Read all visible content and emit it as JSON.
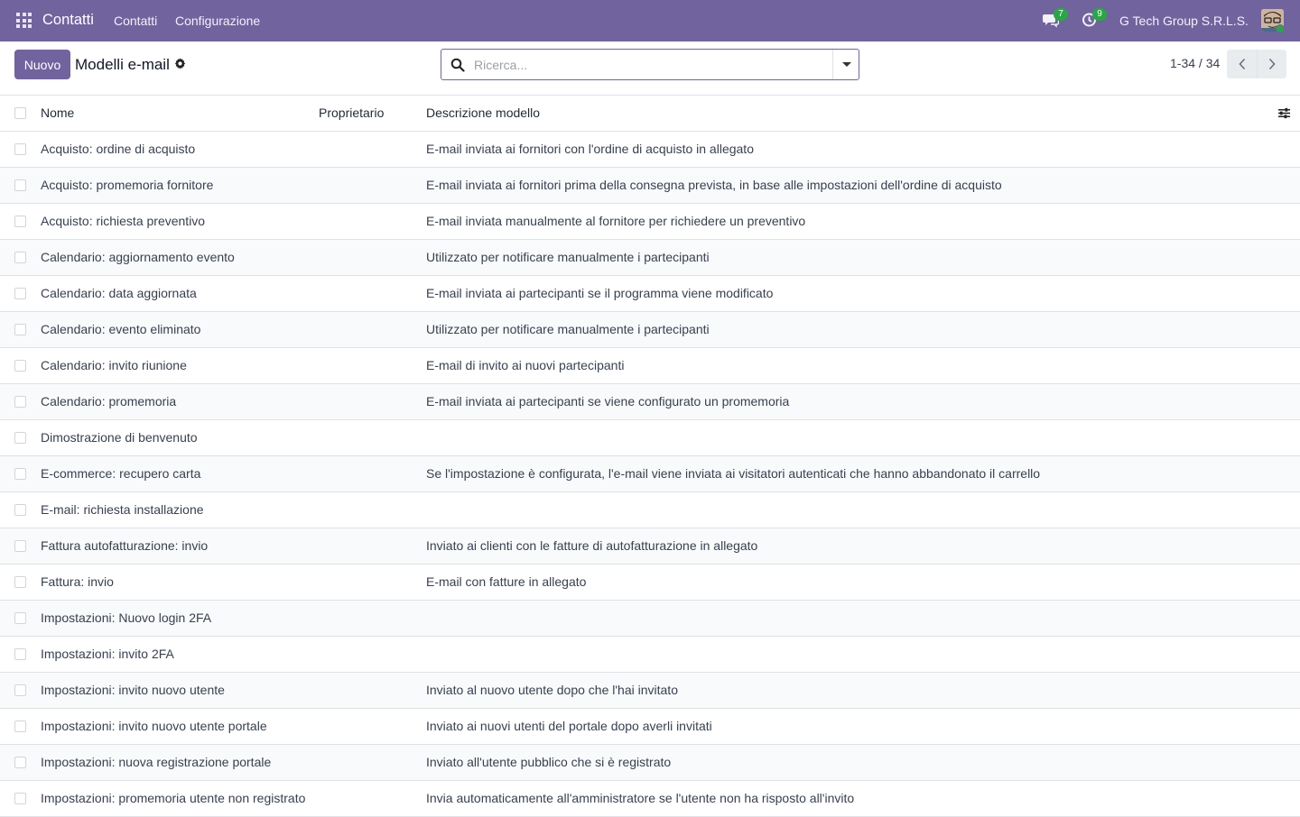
{
  "navbar": {
    "app_name": "Contatti",
    "menu": [
      "Contatti",
      "Configurazione"
    ],
    "messages_count": "7",
    "activities_count": "9",
    "company": "G Tech Group S.R.L.S.",
    "color": "#71639e"
  },
  "control": {
    "new_label": "Nuovo",
    "title": "Modelli e-mail",
    "search_placeholder": "Ricerca...",
    "pager": "1-34 / 34"
  },
  "table": {
    "headers": [
      "Nome",
      "Proprietario",
      "Descrizione modello"
    ],
    "rows": [
      {
        "name": "Acquisto: ordine di acquisto",
        "owner": "",
        "desc": "E-mail inviata ai fornitori con l'ordine di acquisto in allegato"
      },
      {
        "name": "Acquisto: promemoria fornitore",
        "owner": "",
        "desc": "E-mail inviata ai fornitori prima della consegna prevista, in base alle impostazioni dell'ordine di acquisto"
      },
      {
        "name": "Acquisto: richiesta preventivo",
        "owner": "",
        "desc": "E-mail inviata manualmente al fornitore per richiedere un preventivo"
      },
      {
        "name": "Calendario: aggiornamento evento",
        "owner": "",
        "desc": "Utilizzato per notificare manualmente i partecipanti"
      },
      {
        "name": "Calendario: data aggiornata",
        "owner": "",
        "desc": "E-mail inviata ai partecipanti se il programma viene modificato"
      },
      {
        "name": "Calendario: evento eliminato",
        "owner": "",
        "desc": "Utilizzato per notificare manualmente i partecipanti"
      },
      {
        "name": "Calendario: invito riunione",
        "owner": "",
        "desc": "E-mail di invito ai nuovi partecipanti"
      },
      {
        "name": "Calendario: promemoria",
        "owner": "",
        "desc": "E-mail inviata ai partecipanti se viene configurato un promemoria"
      },
      {
        "name": "Dimostrazione di benvenuto",
        "owner": "",
        "desc": ""
      },
      {
        "name": "E-commerce: recupero carta",
        "owner": "",
        "desc": "Se l'impostazione è configurata, l'e-mail viene inviata ai visitatori autenticati che hanno abbandonato il carrello"
      },
      {
        "name": "E-mail: richiesta installazione",
        "owner": "",
        "desc": ""
      },
      {
        "name": "Fattura autofatturazione: invio",
        "owner": "",
        "desc": "Inviato ai clienti con le fatture di autofatturazione in allegato"
      },
      {
        "name": "Fattura: invio",
        "owner": "",
        "desc": "E-mail con fatture in allegato"
      },
      {
        "name": "Impostazioni: Nuovo login 2FA",
        "owner": "",
        "desc": ""
      },
      {
        "name": "Impostazioni: invito 2FA",
        "owner": "",
        "desc": ""
      },
      {
        "name": "Impostazioni: invito nuovo utente",
        "owner": "",
        "desc": "Inviato al nuovo utente dopo che l'hai invitato"
      },
      {
        "name": "Impostazioni: invito nuovo utente portale",
        "owner": "",
        "desc": "Inviato ai nuovi utenti del portale dopo averli invitati"
      },
      {
        "name": "Impostazioni: nuova registrazione portale",
        "owner": "",
        "desc": "Inviato all'utente pubblico che si è registrato"
      },
      {
        "name": "Impostazioni: promemoria utente non registrato",
        "owner": "",
        "desc": "Invia automaticamente all'amministratore se l'utente non ha risposto all'invito"
      }
    ]
  }
}
